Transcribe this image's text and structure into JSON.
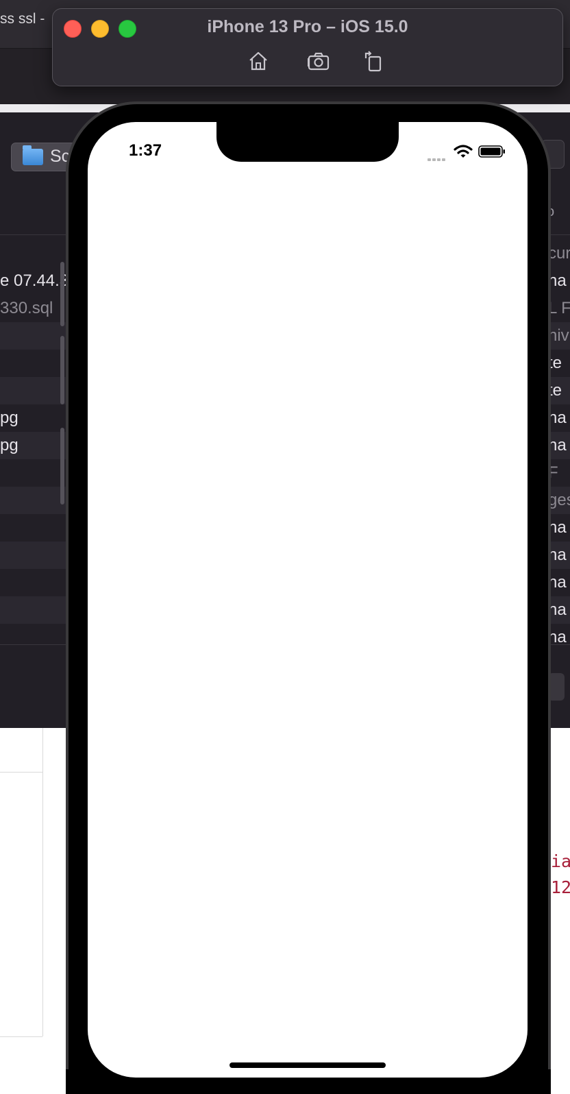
{
  "background": {
    "browser_tab_title": "ss ssl -",
    "finder_path_label": "Sc",
    "header_right": "o",
    "file_rows": [
      {
        "left": "",
        "right": "cur",
        "alt": false
      },
      {
        "left": "e 07.44.3",
        "right": "na",
        "alt": false
      },
      {
        "left": "330.sql",
        "right": "L F",
        "alt": false
      },
      {
        "left": "",
        "right": "hiv",
        "alt": true
      },
      {
        "left": "",
        "right": "te",
        "alt": false
      },
      {
        "left": "",
        "right": "te",
        "alt": true
      },
      {
        "left": "pg",
        "right": "na",
        "alt": false
      },
      {
        "left": "pg",
        "right": "na",
        "alt": true
      },
      {
        "left": "",
        "right": "F",
        "alt": false
      },
      {
        "left": "",
        "right": "ges",
        "alt": true
      },
      {
        "left": "",
        "right": "na",
        "alt": false
      },
      {
        "left": "",
        "right": "na",
        "alt": true
      },
      {
        "left": "",
        "right": "na",
        "alt": false
      },
      {
        "left": "",
        "right": "na",
        "alt": true
      },
      {
        "left": "",
        "right": "na",
        "alt": false
      }
    ],
    "code_lines": [
      "ia",
      "12"
    ]
  },
  "simulator": {
    "title": "iPhone 13 Pro – iOS 15.0",
    "buttons": {
      "home": "home-icon",
      "screenshot": "camera-icon",
      "rotate": "rotate-icon"
    }
  },
  "device": {
    "status_bar": {
      "time": "1:37"
    },
    "screen_content": ""
  },
  "colors": {
    "traffic_close": "#ff5f57",
    "traffic_minimize": "#febc2e",
    "traffic_maximize": "#28c840",
    "screen_background": "#ffffff"
  }
}
